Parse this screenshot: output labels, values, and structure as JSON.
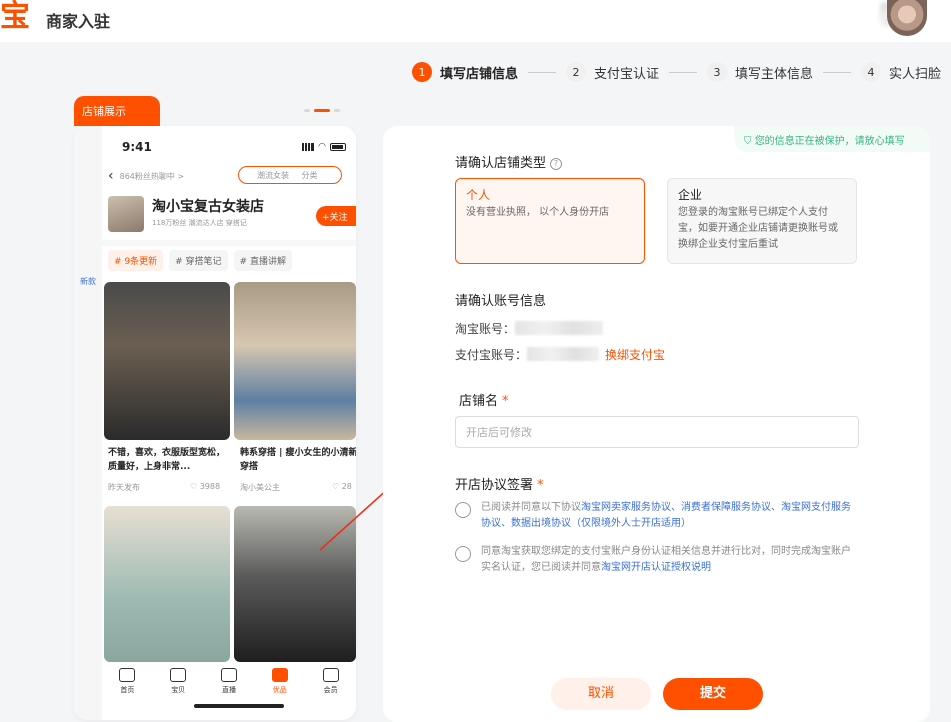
{
  "header": {
    "logo_char": "宝",
    "brand": "商家入驻"
  },
  "steps": [
    {
      "num": "1",
      "label": "填写店铺信息"
    },
    {
      "num": "2",
      "label": "支付宝认证"
    },
    {
      "num": "3",
      "label": "填写主体信息"
    },
    {
      "num": "4",
      "label": "实人扫脸"
    }
  ],
  "preview": {
    "tag": "店铺展示",
    "time": "9:41",
    "nav_meta": "864粉丝热聊中 >",
    "search_placeholder": "潮流女装",
    "search_category": "分类",
    "shop_name": "淘小宝复古女装店",
    "shop_meta": "118万粉丝  潮流达人店  穿搭记",
    "follow": "+关注",
    "tags": [
      "# 9条更新",
      "# 穿搭笔记",
      "# 直播讲解"
    ],
    "side_label": "新款",
    "posts": [
      {
        "caption": "不错，喜欢，衣服版型宽松，质量好，上身非常...",
        "meta": "昨天发布",
        "likes": "♡ 3988"
      },
      {
        "caption": "韩系穿搭 | 瘦小女生的小清新穿搭",
        "meta": "淘小美公主",
        "likes": "♡ 28"
      }
    ],
    "bottom_nav": [
      "首页",
      "宝贝",
      "直播",
      "优品",
      "会员"
    ]
  },
  "form": {
    "protect_text": "您的信息正在被保护，请放心填写",
    "shop_type_title": "请确认店铺类型",
    "personal_title": "个人",
    "personal_desc": "没有营业执照， 以个人身份开店",
    "company_title": "企业",
    "company_desc": "您登录的淘宝账号已绑定个人支付宝，如要开通企业店铺请更换账号或换绑企业支付宝后重试",
    "account_title": "请确认账号信息",
    "taobao_label": "淘宝账号：",
    "alipay_label": "支付宝账号：",
    "rebind": "换绑支付宝",
    "shop_name_label": "店铺名",
    "required": "*",
    "shop_name_placeholder": "开店后可修改",
    "agreement_title": "开店协议签署",
    "agree1_prefix": "已阅读并同意以下协议",
    "agree1_links": "淘宝网卖家服务协议、消费者保障服务协议、淘宝网支付服务协议、数据出境协议（仅限境外人士开店适用）",
    "agree2_prefix": "同意淘宝获取您绑定的支付宝账户身份认证相关信息并进行比对，同时完成淘宝账户实名认证，您已阅读并同意",
    "agree2_link": "淘宝网开店认证授权说明",
    "cancel": "取消",
    "submit": "提交"
  },
  "colors": {
    "accent": "#ff5000",
    "link": "#3b6fd8",
    "protect": "#36b37e"
  }
}
